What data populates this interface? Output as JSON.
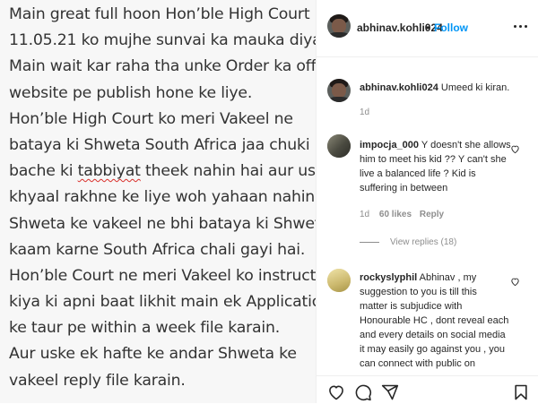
{
  "post": {
    "lines": [
      "Main great full hoon Hon’ble High Court ne",
      "11.05.21 ko mujhe sunvai ka mauka diya.",
      "Main wait kar raha tha unke Order ka official",
      "website pe publish hone ke liye.",
      "Hon’ble High Court ko meri Vakeel ne",
      "bataya ki Shweta South Africa jaa chuki hai,",
      "bache ki tabbiyat theek nahin hai aur uska",
      "khyaal rakhne ke liye woh yahaan nahin hai.",
      "Shweta ke vakeel ne bhi bataya ki Shweta",
      "kaam karne South Africa chali gayi hai.",
      "Hon’ble Court ne meri Vakeel ko instruct",
      "kiya ki apni baat likhit main ek Application",
      "ke taur pe within a week file karain.",
      "Aur uske ek hafte ke andar Shweta ke",
      "vakeel reply file karain."
    ],
    "line7": {
      "before": "bache ki ",
      "underlined": "tabbiyat",
      "after": " theek nahin hai aur uska"
    }
  },
  "header": {
    "username": "abhinav.kohli024",
    "dot": "•",
    "follow": "Follow"
  },
  "comments": {
    "caption": {
      "username": "abhinav.kohli024",
      "text": "Umeed ki kiran.",
      "time": "1d"
    },
    "c1": {
      "username": "impocja_000",
      "lines": [
        "Y doesn't she allows",
        "him to meet his kid ?? Y can't she",
        "live a balanced life ? Kid is",
        "suffering in between"
      ],
      "time": "1d",
      "likes": "60 likes",
      "reply": "Reply",
      "view_replies": "View replies (18)"
    },
    "c2": {
      "username": "rockyslyphil",
      "lines": [
        "Abhinav , my",
        "suggestion to you is till this",
        "matter is subjudice with",
        "Honourable HC , dont reveal each",
        "and every details on social media",
        "it may easily go against you , you",
        "can connect with public on"
      ]
    }
  },
  "icons": {
    "like": "heart-icon",
    "comment": "comment-icon",
    "share": "paper-plane-icon",
    "save": "bookmark-icon",
    "more": "more-options-icon"
  },
  "colors": {
    "accent": "#0095f6",
    "muted": "#8e8e8e",
    "text": "#262626",
    "spellcheck": "#d9302c"
  }
}
